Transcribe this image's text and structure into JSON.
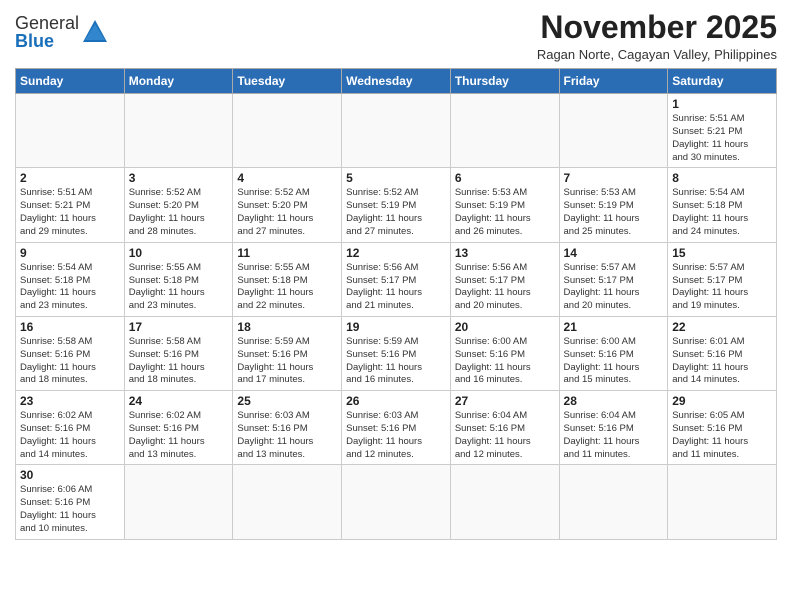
{
  "logo": {
    "text_general": "General",
    "text_blue": "Blue"
  },
  "title": "November 2025",
  "subtitle": "Ragan Norte, Cagayan Valley, Philippines",
  "header_days": [
    "Sunday",
    "Monday",
    "Tuesday",
    "Wednesday",
    "Thursday",
    "Friday",
    "Saturday"
  ],
  "weeks": [
    [
      {
        "day": "",
        "info": ""
      },
      {
        "day": "",
        "info": ""
      },
      {
        "day": "",
        "info": ""
      },
      {
        "day": "",
        "info": ""
      },
      {
        "day": "",
        "info": ""
      },
      {
        "day": "",
        "info": ""
      },
      {
        "day": "1",
        "info": "Sunrise: 5:51 AM\nSunset: 5:21 PM\nDaylight: 11 hours\nand 30 minutes."
      }
    ],
    [
      {
        "day": "2",
        "info": "Sunrise: 5:51 AM\nSunset: 5:21 PM\nDaylight: 11 hours\nand 29 minutes."
      },
      {
        "day": "3",
        "info": "Sunrise: 5:52 AM\nSunset: 5:20 PM\nDaylight: 11 hours\nand 28 minutes."
      },
      {
        "day": "4",
        "info": "Sunrise: 5:52 AM\nSunset: 5:20 PM\nDaylight: 11 hours\nand 27 minutes."
      },
      {
        "day": "5",
        "info": "Sunrise: 5:52 AM\nSunset: 5:19 PM\nDaylight: 11 hours\nand 27 minutes."
      },
      {
        "day": "6",
        "info": "Sunrise: 5:53 AM\nSunset: 5:19 PM\nDaylight: 11 hours\nand 26 minutes."
      },
      {
        "day": "7",
        "info": "Sunrise: 5:53 AM\nSunset: 5:19 PM\nDaylight: 11 hours\nand 25 minutes."
      },
      {
        "day": "8",
        "info": "Sunrise: 5:54 AM\nSunset: 5:18 PM\nDaylight: 11 hours\nand 24 minutes."
      }
    ],
    [
      {
        "day": "9",
        "info": "Sunrise: 5:54 AM\nSunset: 5:18 PM\nDaylight: 11 hours\nand 23 minutes."
      },
      {
        "day": "10",
        "info": "Sunrise: 5:55 AM\nSunset: 5:18 PM\nDaylight: 11 hours\nand 23 minutes."
      },
      {
        "day": "11",
        "info": "Sunrise: 5:55 AM\nSunset: 5:18 PM\nDaylight: 11 hours\nand 22 minutes."
      },
      {
        "day": "12",
        "info": "Sunrise: 5:56 AM\nSunset: 5:17 PM\nDaylight: 11 hours\nand 21 minutes."
      },
      {
        "day": "13",
        "info": "Sunrise: 5:56 AM\nSunset: 5:17 PM\nDaylight: 11 hours\nand 20 minutes."
      },
      {
        "day": "14",
        "info": "Sunrise: 5:57 AM\nSunset: 5:17 PM\nDaylight: 11 hours\nand 20 minutes."
      },
      {
        "day": "15",
        "info": "Sunrise: 5:57 AM\nSunset: 5:17 PM\nDaylight: 11 hours\nand 19 minutes."
      }
    ],
    [
      {
        "day": "16",
        "info": "Sunrise: 5:58 AM\nSunset: 5:16 PM\nDaylight: 11 hours\nand 18 minutes."
      },
      {
        "day": "17",
        "info": "Sunrise: 5:58 AM\nSunset: 5:16 PM\nDaylight: 11 hours\nand 18 minutes."
      },
      {
        "day": "18",
        "info": "Sunrise: 5:59 AM\nSunset: 5:16 PM\nDaylight: 11 hours\nand 17 minutes."
      },
      {
        "day": "19",
        "info": "Sunrise: 5:59 AM\nSunset: 5:16 PM\nDaylight: 11 hours\nand 16 minutes."
      },
      {
        "day": "20",
        "info": "Sunrise: 6:00 AM\nSunset: 5:16 PM\nDaylight: 11 hours\nand 16 minutes."
      },
      {
        "day": "21",
        "info": "Sunrise: 6:00 AM\nSunset: 5:16 PM\nDaylight: 11 hours\nand 15 minutes."
      },
      {
        "day": "22",
        "info": "Sunrise: 6:01 AM\nSunset: 5:16 PM\nDaylight: 11 hours\nand 14 minutes."
      }
    ],
    [
      {
        "day": "23",
        "info": "Sunrise: 6:02 AM\nSunset: 5:16 PM\nDaylight: 11 hours\nand 14 minutes."
      },
      {
        "day": "24",
        "info": "Sunrise: 6:02 AM\nSunset: 5:16 PM\nDaylight: 11 hours\nand 13 minutes."
      },
      {
        "day": "25",
        "info": "Sunrise: 6:03 AM\nSunset: 5:16 PM\nDaylight: 11 hours\nand 13 minutes."
      },
      {
        "day": "26",
        "info": "Sunrise: 6:03 AM\nSunset: 5:16 PM\nDaylight: 11 hours\nand 12 minutes."
      },
      {
        "day": "27",
        "info": "Sunrise: 6:04 AM\nSunset: 5:16 PM\nDaylight: 11 hours\nand 12 minutes."
      },
      {
        "day": "28",
        "info": "Sunrise: 6:04 AM\nSunset: 5:16 PM\nDaylight: 11 hours\nand 11 minutes."
      },
      {
        "day": "29",
        "info": "Sunrise: 6:05 AM\nSunset: 5:16 PM\nDaylight: 11 hours\nand 11 minutes."
      }
    ],
    [
      {
        "day": "30",
        "info": "Sunrise: 6:06 AM\nSunset: 5:16 PM\nDaylight: 11 hours\nand 10 minutes."
      },
      {
        "day": "",
        "info": ""
      },
      {
        "day": "",
        "info": ""
      },
      {
        "day": "",
        "info": ""
      },
      {
        "day": "",
        "info": ""
      },
      {
        "day": "",
        "info": ""
      },
      {
        "day": "",
        "info": ""
      }
    ]
  ]
}
